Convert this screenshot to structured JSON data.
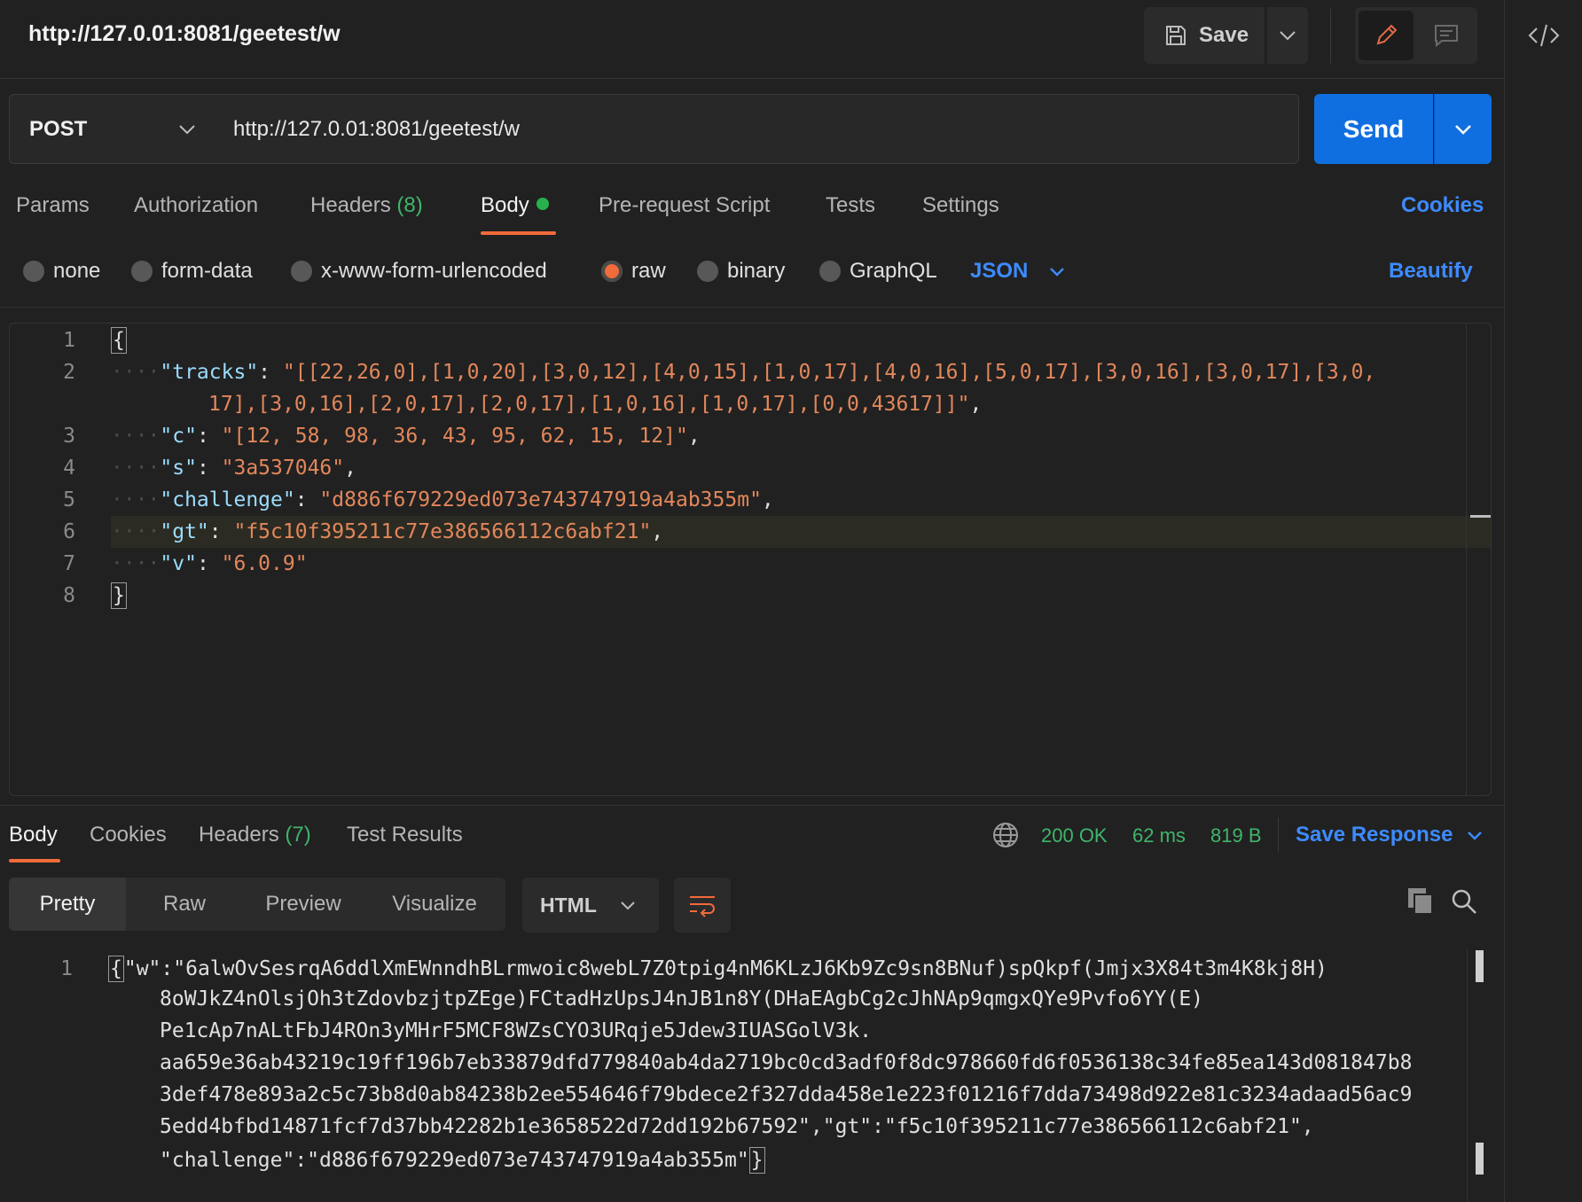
{
  "request": {
    "title": "http://127.0.01:8081/geetest/w",
    "save_label": "Save",
    "method": "POST",
    "url": "http://127.0.01:8081/geetest/w",
    "send_label": "Send"
  },
  "request_tabs": {
    "params": "Params",
    "authorization": "Authorization",
    "headers": "Headers",
    "headers_count": "(8)",
    "body": "Body",
    "pre_request": "Pre-request Script",
    "tests": "Tests",
    "settings": "Settings",
    "cookies": "Cookies"
  },
  "body_types": {
    "none": "none",
    "form_data": "form-data",
    "urlencoded": "x-www-form-urlencoded",
    "raw": "raw",
    "binary": "binary",
    "graphql": "GraphQL",
    "selected": "raw",
    "language": "JSON",
    "beautify": "Beautify"
  },
  "editor": {
    "line_numbers": [
      "1",
      "2",
      "",
      "3",
      "4",
      "5",
      "6",
      "7",
      "8"
    ],
    "open_brace": "{",
    "close_brace": "}",
    "tracks_key": "\"tracks\"",
    "tracks_value_1": "\"[[22,26,0],[1,0,20],[3,0,12],[4,0,15],[1,0,17],[4,0,16],[5,0,17],[3,0,16],[3,0,17],[3,0,",
    "tracks_value_2": "17],[3,0,16],[2,0,17],[2,0,17],[1,0,16],[1,0,17],[0,0,43617]]\"",
    "c_key": "\"c\"",
    "c_value": "\"[12, 58, 98, 36, 43, 95, 62, 15, 12]\"",
    "s_key": "\"s\"",
    "s_value": "\"3a537046\"",
    "challenge_key": "\"challenge\"",
    "challenge_value": "\"d886f679229ed073e743747919a4ab355m\"",
    "gt_key": "\"gt\"",
    "gt_value": "\"f5c10f395211c77e386566112c6abf21\"",
    "v_key": "\"v\"",
    "v_value": "\"6.0.9\"",
    "highlighted_line": 6
  },
  "response_tabs": {
    "body": "Body",
    "cookies": "Cookies",
    "headers": "Headers",
    "headers_count": "(7)",
    "test_results": "Test Results"
  },
  "response_status": {
    "status": "200 OK",
    "time": "62 ms",
    "size": "819 B",
    "save_response": "Save Response"
  },
  "response_view": {
    "pretty": "Pretty",
    "raw": "Raw",
    "preview": "Preview",
    "visualize": "Visualize",
    "format": "HTML"
  },
  "response_body": {
    "line_number": "1",
    "lines": [
      "\"w\":\"6alwOvSesrqA6ddlXmEWnndhBLrmwoic8webL7Z0tpig4nM6KLzJ6Kb9Zc9sn8BNuf)spQkpf(Jmjx3X84t3m4K8kj8H)",
      "8oWJkZ4nOlsjOh3tZdovbzjtpZEge)FCtadHzUpsJ4nJB1n8Y(DHaEAgbCg2cJhNAp9qmgxQYe9Pvfo6YY(E)",
      "Pe1cAp7nALtFbJ4ROn3yMHrF5MCF8WZsCYO3URqje5Jdew3IUASGolV3k.",
      "aa659e36ab43219c19ff196b7eb33879dfd779840ab4da2719bc0cd3adf0f8dc978660fd6f0536138c34fe85ea143d081847b8",
      "3def478e893a2c5c73b8d0ab84238b2ee554646f79bdece2f327dda458e1e223f01216f7dda73498d922e81c3234adaad56ac9",
      "5edd4bfbd14871fcf7d37bb42282b1e3658522d72dd192b67592\",\"gt\":\"f5c10f395211c77e386566112c6abf21\",",
      "\"challenge\":\"d886f679229ed073e743747919a4ab355m\""
    ]
  },
  "icons": {
    "save": "floppy-disk-icon",
    "caret": "chevron-down-icon",
    "edit": "pencil-icon",
    "comment": "comment-icon",
    "code": "code-icon",
    "globe": "globe-icon",
    "wrap": "wrap-lines-icon",
    "copy": "copy-icon",
    "search": "search-icon"
  },
  "colors": {
    "accent_orange": "#f26b3a",
    "link_blue": "#3d8bff",
    "send_blue": "#0f6fe0",
    "status_green": "#3fb56a",
    "string_orange": "#e2875b",
    "key_blue": "#9cdcfe"
  }
}
